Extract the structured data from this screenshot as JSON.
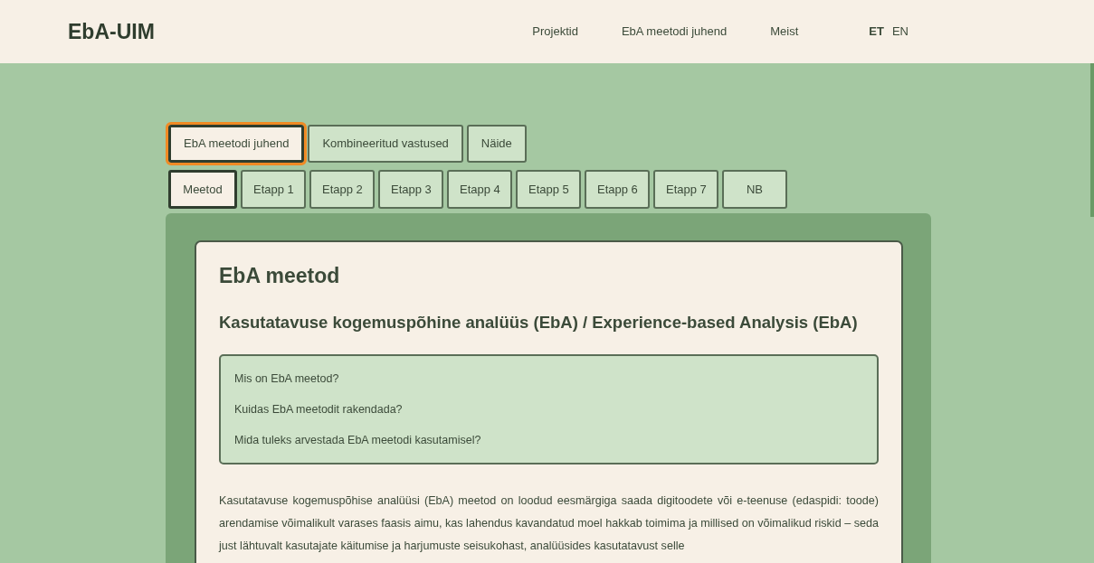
{
  "header": {
    "logo": "EbA-UIM",
    "nav": [
      {
        "label": "Projektid"
      },
      {
        "label": "EbA meetodi juhend"
      },
      {
        "label": "Meist"
      }
    ],
    "languages": [
      {
        "label": "ET",
        "selected": true
      },
      {
        "label": "EN",
        "selected": false
      }
    ]
  },
  "main_tabs": [
    {
      "label": "EbA meetodi juhend",
      "selected": true
    },
    {
      "label": "Kombineeritud vastused",
      "selected": false
    },
    {
      "label": "Näide",
      "selected": false
    }
  ],
  "sub_tabs": [
    {
      "label": "Meetod",
      "selected": true
    },
    {
      "label": "Etapp 1",
      "selected": false
    },
    {
      "label": "Etapp 2",
      "selected": false
    },
    {
      "label": "Etapp 3",
      "selected": false
    },
    {
      "label": "Etapp 4",
      "selected": false
    },
    {
      "label": "Etapp 5",
      "selected": false
    },
    {
      "label": "Etapp 6",
      "selected": false
    },
    {
      "label": "Etapp 7",
      "selected": false
    },
    {
      "label": "NB",
      "selected": false
    }
  ],
  "content": {
    "title": "EbA meetod",
    "subtitle": "Kasutatavuse kogemuspõhine analüüs (EbA) / Experience-based Analysis (EbA)",
    "questions": [
      "Mis on EbA meetod?",
      "Kuidas EbA meetodit rakendada?",
      "Mida tuleks arvestada EbA meetodi kasutamisel?"
    ],
    "paragraph": "Kasutatavuse kogemuspõhise analüüsi (EbA) meetod on loodud eesmärgiga saada digitoodete või e-teenuse (edaspidi: toode) arendamise võimalikult varases faasis aimu, kas lahendus kavandatud moel hakkab toimima ja millised on võimalikud riskid – seda just lähtuvalt kasutajate käitumise ja harjumuste seisukohast, analüüsides kasutatavust selle"
  }
}
